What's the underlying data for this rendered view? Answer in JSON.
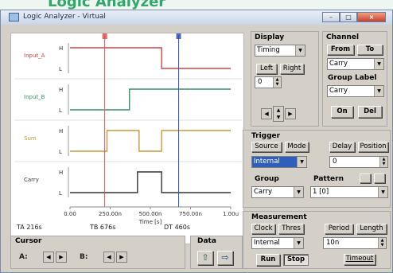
{
  "banner_text": "Logic Analyzer",
  "window": {
    "title": "Logic Analyzer - Virtual",
    "minimize_glyph": "–",
    "maximize_glyph": "□",
    "close_glyph": "×"
  },
  "chart_data": {
    "type": "line",
    "x": [
      0,
      250,
      500,
      750,
      1000
    ],
    "xtick_labels": [
      "0.00",
      "250.00n",
      "500.00n",
      "750.00n",
      "1.00u"
    ],
    "xlabel": "Time [s]",
    "xlim": [
      0,
      1000
    ],
    "ylevel_labels": [
      "H",
      "L"
    ],
    "series": [
      {
        "name": "Input_A",
        "color": "#d04545",
        "edges": [
          [
            0,
            1
          ],
          [
            570,
            0
          ]
        ]
      },
      {
        "name": "Input_B",
        "color": "#3a9068",
        "edges": [
          [
            0,
            0
          ],
          [
            370,
            1
          ]
        ]
      },
      {
        "name": "Sum",
        "color": "#c89a3c",
        "edges": [
          [
            0,
            0
          ],
          [
            230,
            1
          ],
          [
            430,
            0
          ],
          [
            570,
            1
          ]
        ]
      },
      {
        "name": "Carry",
        "color": "#333333",
        "edges": [
          [
            0,
            0
          ],
          [
            420,
            1
          ],
          [
            570,
            0
          ]
        ]
      }
    ],
    "cursors": [
      {
        "id": "T1",
        "x": 216,
        "color": "#e05050"
      },
      {
        "id": "T2",
        "x": 676,
        "color": "#3050c0"
      }
    ]
  },
  "readouts": {
    "ta": "TA  216s",
    "tb": "TB  676s",
    "dt": "DT  460s"
  },
  "cursor": {
    "title": "Cursor",
    "a_label": "A:",
    "b_label": "B:",
    "left_glyph": "◀",
    "right_glyph": "▶"
  },
  "data_panel": {
    "title": "Data",
    "export_glyph": "⇧",
    "import_glyph": "⇨"
  },
  "display": {
    "title": "Display",
    "mode_value": "Timing",
    "left_label": "Left",
    "right_label": "Right",
    "offset_value": "0",
    "left_glyph": "◀",
    "right_glyph": "▶",
    "up_glyph": "▲",
    "down_glyph": "▼"
  },
  "channel": {
    "title": "Channel",
    "from_label": "From",
    "to_label": "To",
    "channel_value": "Carry",
    "group_label_title": "Group Label",
    "group_label_value": "Carry",
    "on_label": "On",
    "del_label": "Del"
  },
  "trigger": {
    "title": "Trigger",
    "source_label": "Source",
    "mode_label": "Mode",
    "delay_label": "Delay",
    "position_label": "Position",
    "source_value": "Internal",
    "delay_value": "0",
    "group_title": "Group",
    "group_value": "Carry",
    "pattern_title": "Pattern",
    "pattern_value": "1 [0]"
  },
  "measurement": {
    "title": "Measurement",
    "clock_label": "Clock",
    "thres_label": "Thres",
    "period_label": "Period",
    "length_label": "Length",
    "source_value": "Internal",
    "period_value": "10n",
    "run_label": "Run",
    "stop_label": "Stop",
    "timeout_label": "Timeout"
  }
}
